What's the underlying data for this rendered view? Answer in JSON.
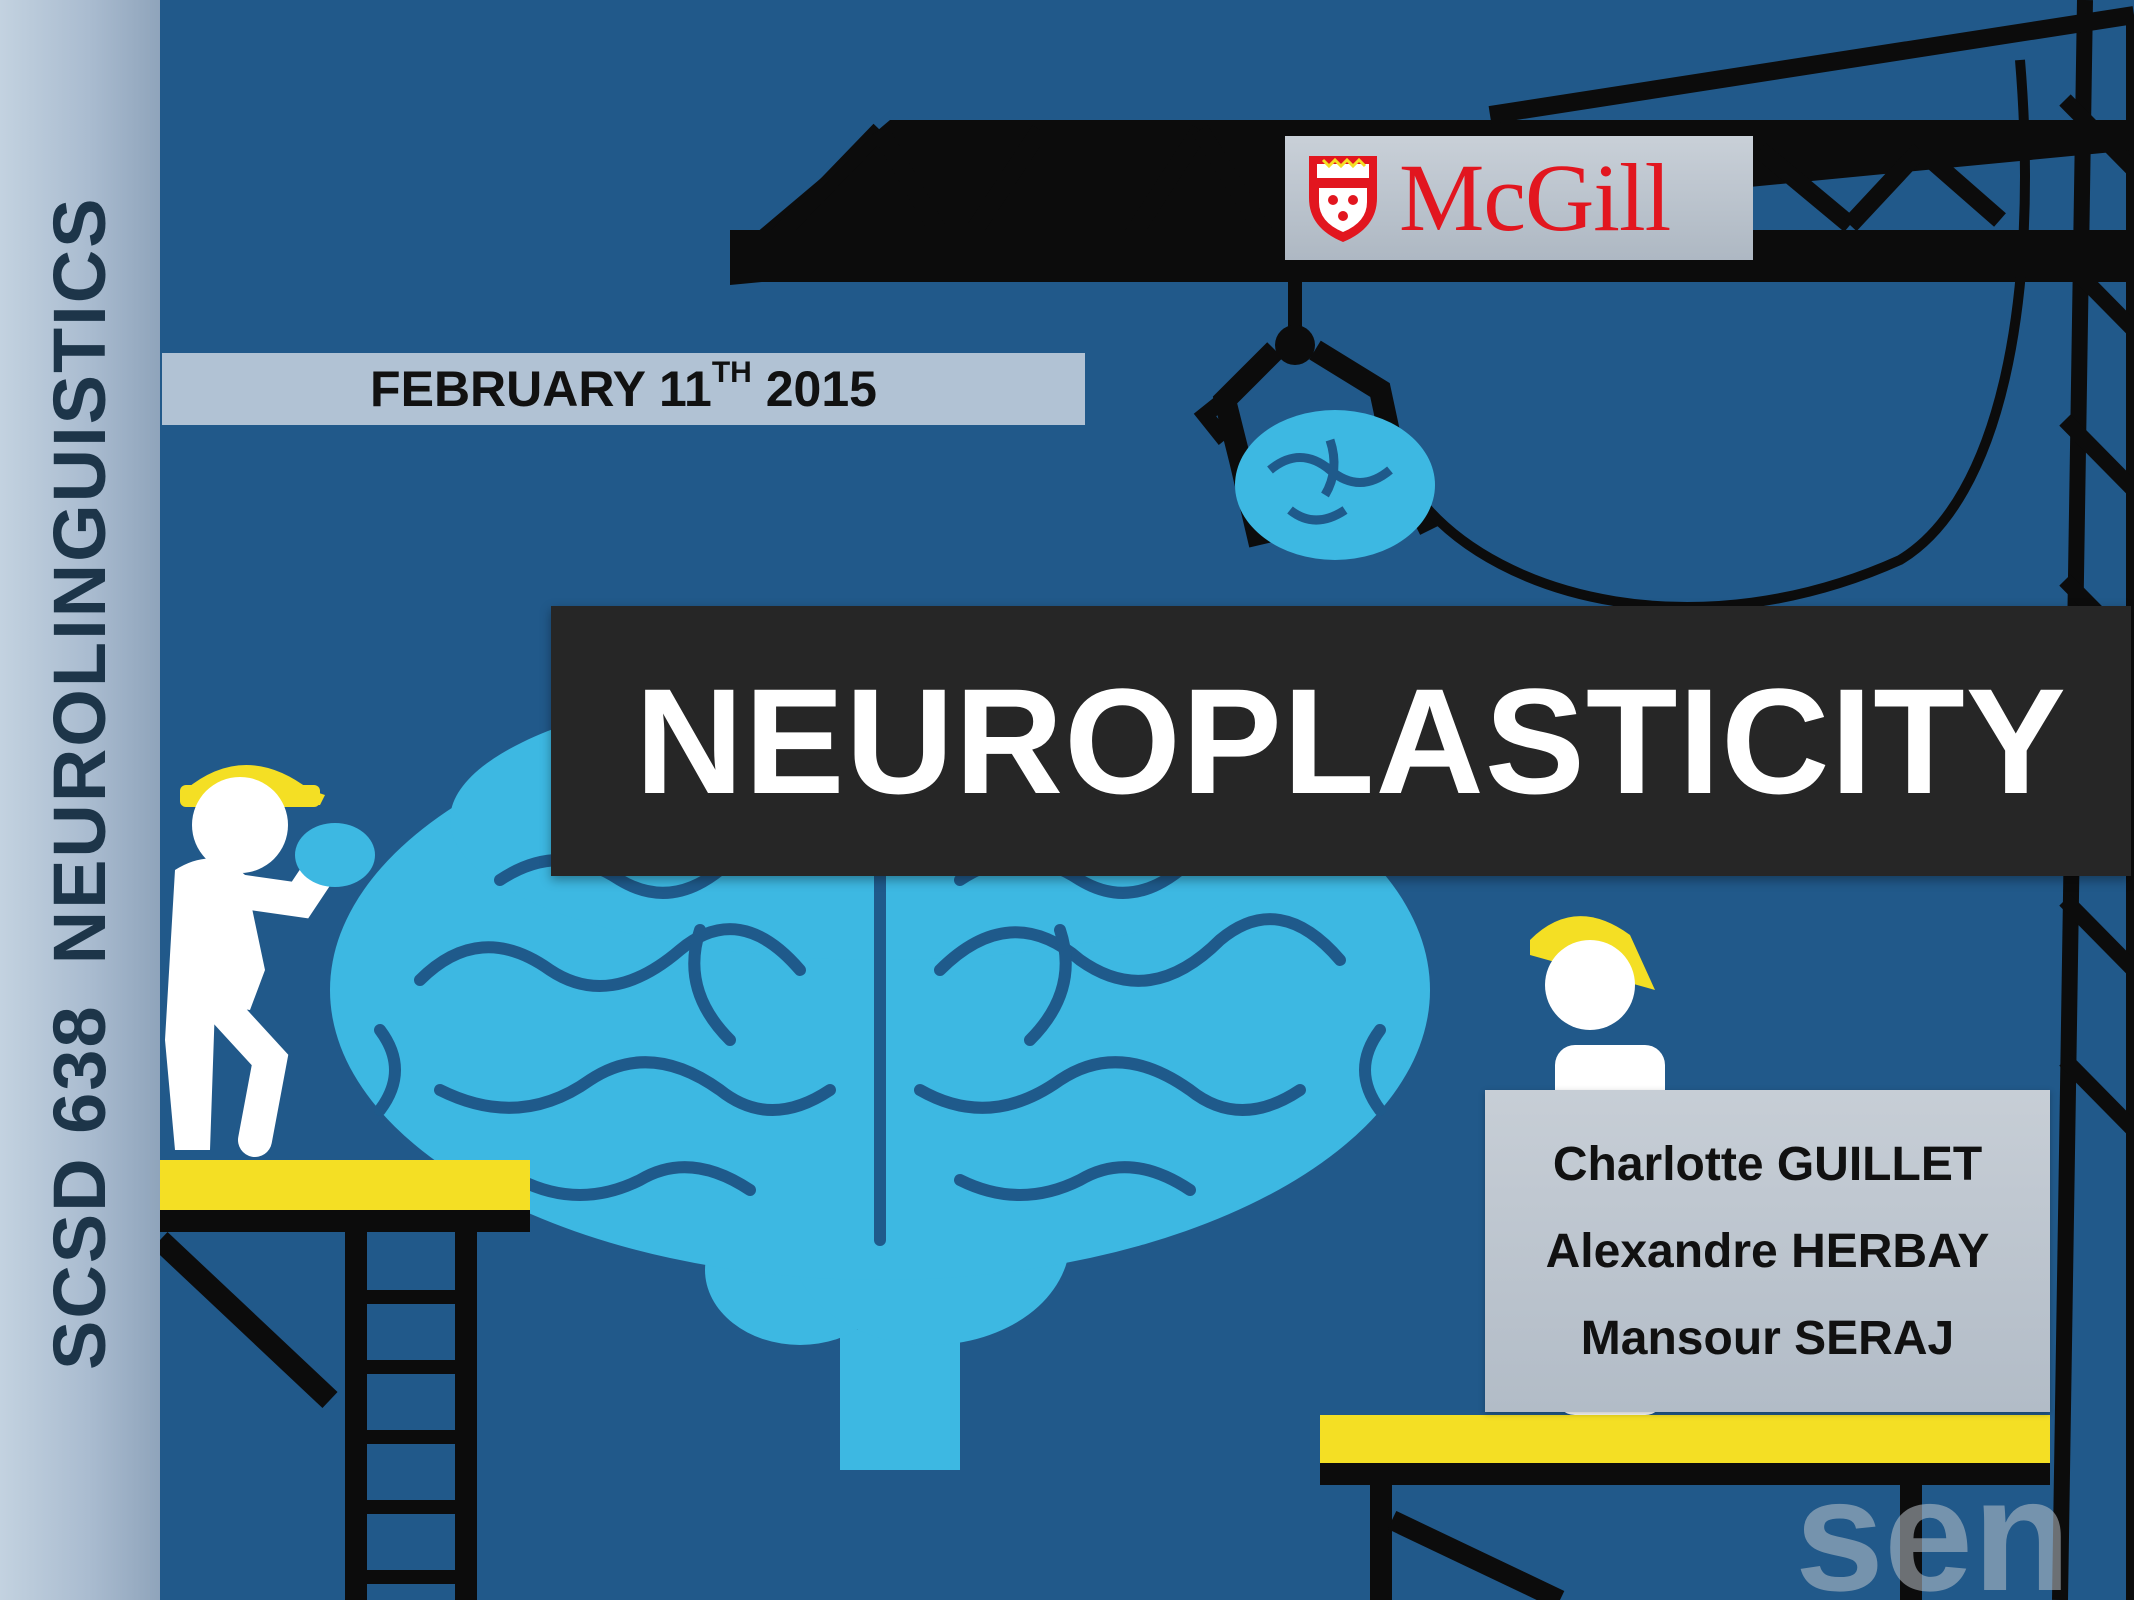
{
  "slide": {
    "sidebar": {
      "course_code": "SCSD 638",
      "course_name": "NEUROLINGUISTICS"
    },
    "date": {
      "prefix": "FEBRUARY 11",
      "suffix": "TH",
      "year": " 2015"
    },
    "title": "NEUROPLASTICITY",
    "logo": {
      "wordmark": "McGill",
      "icon": "mcgill-shield-icon"
    },
    "authors": [
      "Charlotte GUILLET",
      "Alexandre HERBAY",
      "Mansour SERAJ"
    ],
    "watermark": "sen"
  },
  "colors": {
    "background": "#21598a",
    "brain": "#3db8e2",
    "brain_outline": "#1f5a8b",
    "accent_yellow": "#f4df24",
    "crane": "#0c0c0c",
    "title_bar": "#262626",
    "mcgill_red": "#e2161f"
  }
}
